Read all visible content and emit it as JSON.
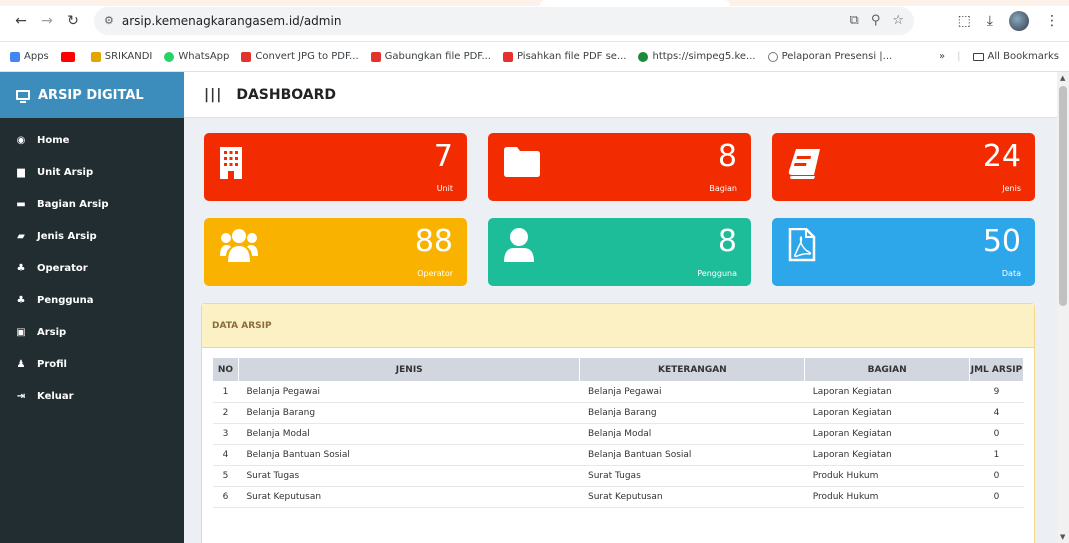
{
  "browser": {
    "url": "arsip.kemenagkarangasem.id/admin",
    "bookmarks": [
      {
        "label": "Apps",
        "color": "#4285f4"
      },
      {
        "label": "",
        "color": "#ff0000"
      },
      {
        "label": "SRIKANDI",
        "color": "#e5a500"
      },
      {
        "label": "WhatsApp",
        "color": "#25d366"
      },
      {
        "label": "Convert JPG to PDF...",
        "color": "#e5322d"
      },
      {
        "label": "Gabungkan file PDF...",
        "color": "#e5322d"
      },
      {
        "label": "Pisahkan file PDF se...",
        "color": "#e5322d"
      },
      {
        "label": "https://simpeg5.ke...",
        "color": "#1b8a3a"
      },
      {
        "label": "Pelaporan Presensi |...",
        "color": "#777777"
      }
    ],
    "more": "»",
    "all_bookmarks": "All Bookmarks"
  },
  "sidebar": {
    "brand": "ARSIP DIGITAL",
    "items": [
      {
        "label": "Home",
        "icon": "dashboard-icon",
        "glyph": "◉"
      },
      {
        "label": "Unit Arsip",
        "icon": "building-icon",
        "glyph": "▆"
      },
      {
        "label": "Bagian Arsip",
        "icon": "folder-icon",
        "glyph": "▬"
      },
      {
        "label": "Jenis Arsip",
        "icon": "book-icon",
        "glyph": "▰"
      },
      {
        "label": "Operator",
        "icon": "users-icon",
        "glyph": "♣"
      },
      {
        "label": "Pengguna",
        "icon": "users-icon",
        "glyph": "♣"
      },
      {
        "label": "Arsip",
        "icon": "file-pdf-icon",
        "glyph": "▣"
      },
      {
        "label": "Profil",
        "icon": "user-icon",
        "glyph": "♟"
      },
      {
        "label": "Keluar",
        "icon": "sign-out-icon",
        "glyph": "⇥"
      }
    ]
  },
  "header": {
    "title": "DASHBOARD"
  },
  "tiles": [
    {
      "value": "7",
      "label": "Unit",
      "color": "#f22c00",
      "icon": "building-icon"
    },
    {
      "value": "8",
      "label": "Bagian",
      "color": "#f22c00",
      "icon": "folder-icon"
    },
    {
      "value": "24",
      "label": "Jenis",
      "color": "#f22c00",
      "icon": "book-icon"
    },
    {
      "value": "88",
      "label": "Operator",
      "color": "#f9b200",
      "icon": "users-icon"
    },
    {
      "value": "8",
      "label": "Pengguna",
      "color": "#1dbd9a",
      "icon": "user-icon"
    },
    {
      "value": "50",
      "label": "Data",
      "color": "#2ea6ea",
      "icon": "file-pdf-icon"
    }
  ],
  "panel": {
    "title": "DATA ARSIP",
    "columns": [
      "NO",
      "JENIS",
      "KETERANGAN",
      "BAGIAN",
      "JML ARSIP"
    ],
    "rows": [
      [
        "1",
        "Belanja Pegawai",
        "Belanja Pegawai",
        "Laporan Kegiatan",
        "9"
      ],
      [
        "2",
        "Belanja Barang",
        "Belanja Barang",
        "Laporan Kegiatan",
        "4"
      ],
      [
        "3",
        "Belanja Modal",
        "Belanja Modal",
        "Laporan Kegiatan",
        "0"
      ],
      [
        "4",
        "Belanja Bantuan Sosial",
        "Belanja Bantuan Sosial",
        "Laporan Kegiatan",
        "1"
      ],
      [
        "5",
        "Surat Tugas",
        "Surat Tugas",
        "Produk Hukum",
        "0"
      ],
      [
        "6",
        "Surat Keputusan",
        "Surat Keputusan",
        "Produk Hukum",
        "0"
      ]
    ]
  }
}
